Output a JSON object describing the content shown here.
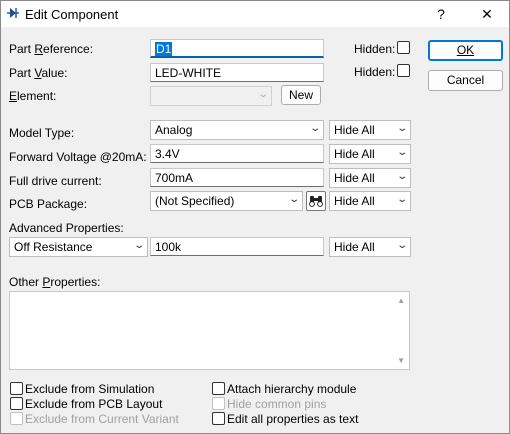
{
  "window": {
    "title": "Edit Component",
    "help_glyph": "?",
    "close_glyph": "✕"
  },
  "fields": {
    "part_reference": {
      "label": "Part Reference:",
      "value": "D1"
    },
    "part_value": {
      "label": "Part Value:",
      "value": "LED-WHITE"
    },
    "element": {
      "label": "Element:",
      "value": "",
      "new_button": "New"
    },
    "hidden_label_1": "Hidden:",
    "hidden_label_2": "Hidden:",
    "model_type": {
      "label": "Model Type:",
      "value": "Analog",
      "visibility": "Hide All"
    },
    "forward_voltage": {
      "label": "Forward Voltage @20mA:",
      "value": "3.4V",
      "visibility": "Hide All"
    },
    "full_drive_current": {
      "label": "Full drive current:",
      "value": "700mA",
      "visibility": "Hide All"
    },
    "pcb_package": {
      "label": "PCB Package:",
      "value": "(Not Specified)",
      "visibility": "Hide All"
    },
    "advanced_properties": {
      "label": "Advanced Properties:",
      "property": "Off Resistance",
      "value": "100k",
      "visibility": "Hide All"
    },
    "other_properties": {
      "label": "Other Properties:",
      "value": ""
    }
  },
  "buttons": {
    "ok": "OK",
    "cancel": "Cancel"
  },
  "options": {
    "exclude_simulation": {
      "label": "Exclude from Simulation",
      "checked": false
    },
    "exclude_pcb": {
      "label": "Exclude from PCB Layout",
      "checked": false
    },
    "exclude_variant": {
      "label": "Exclude from Current Variant",
      "checked": false,
      "enabled": false
    },
    "attach_hierarchy": {
      "label": "Attach hierarchy module",
      "checked": false
    },
    "hide_common_pins": {
      "label": "Hide common pins",
      "checked": false,
      "enabled": false
    },
    "edit_all_properties": {
      "label": "Edit all properties as text",
      "checked": false
    }
  },
  "colors": {
    "accent": "#0078d7",
    "dialog_bg": "#f0f0f0"
  }
}
